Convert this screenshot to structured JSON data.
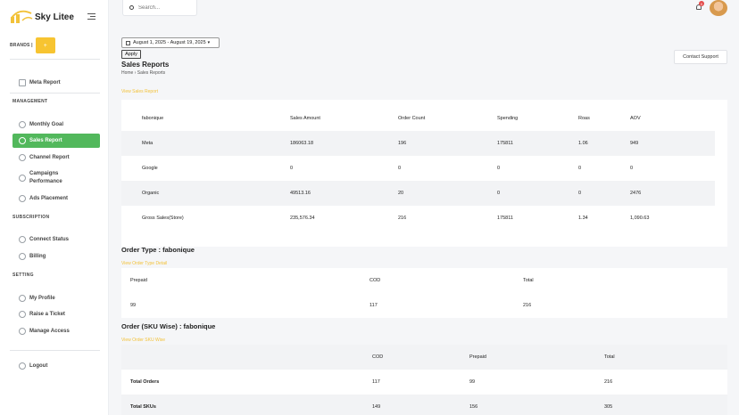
{
  "brand": {
    "name": "Sky Litee"
  },
  "sidebar": {
    "brands_label": "BRANDS |",
    "brand_button": "+",
    "top_items": [
      {
        "label": "Meta Report",
        "icon": "grid-icon"
      }
    ],
    "sections": {
      "management": "MANAGEMENT",
      "subscription": "SUBSCRIPTION",
      "setting": "SETTING"
    },
    "management_items": [
      {
        "label": "Monthly Goal"
      },
      {
        "label": "Sales Report"
      },
      {
        "label": "Channel Report"
      },
      {
        "label": "Campaigns Performance"
      },
      {
        "label": "Ads Placement"
      }
    ],
    "subscription_items": [
      {
        "label": "Connect Status"
      },
      {
        "label": "Billing"
      }
    ],
    "setting_items": [
      {
        "label": "My Profile"
      },
      {
        "label": "Raise a Ticket"
      },
      {
        "label": "Manage Access"
      }
    ],
    "logout": "Logout"
  },
  "header": {
    "search_placeholder": "Search...",
    "notification_count": "0"
  },
  "filters": {
    "date_range": "August 1, 2025 - August 19, 2025",
    "apply_label": "Apply"
  },
  "page": {
    "title": "Sales Reports",
    "breadcrumb": "Home  ›  Sales Reports",
    "support_label": "Contact Support",
    "view_sales_link": "View Sales Report"
  },
  "sales_table": {
    "headers": [
      "fabonique",
      "Sales Amount",
      "Order Count",
      "Spending",
      "Roas",
      "AOV"
    ],
    "rows": [
      [
        "Meta",
        "186063.18",
        "196",
        "175811",
        "1.06",
        "949"
      ],
      [
        "Google",
        "0",
        "0",
        "0",
        "0",
        "0"
      ],
      [
        "Organic",
        "49513.16",
        "20",
        "0",
        "0",
        "2476"
      ],
      [
        "Gross Sales(Store)",
        "235,576.34",
        "216",
        "175811",
        "1.34",
        "1,090.63"
      ]
    ]
  },
  "order_type": {
    "title": "Order Type : fabonique",
    "link": "View Order Type Detail",
    "headers": [
      "Prepaid",
      "COD",
      "Total"
    ],
    "rows": [
      [
        "99",
        "117",
        "216"
      ]
    ]
  },
  "sku": {
    "title": "Order (SKU Wise) : fabonique",
    "link": "View Order SKU Wise",
    "headers": [
      "",
      "COD",
      "Prepaid",
      "Total"
    ],
    "rows": [
      [
        "Total Orders",
        "117",
        "99",
        "216"
      ],
      [
        "Total SKUs",
        "149",
        "156",
        "305"
      ]
    ]
  }
}
